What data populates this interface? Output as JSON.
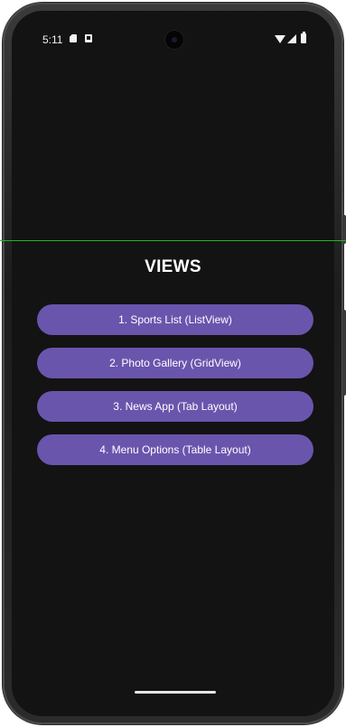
{
  "status_bar": {
    "time": "5:11"
  },
  "page": {
    "title": "VIEWS"
  },
  "menu": {
    "items": [
      {
        "label": "1. Sports List (ListView)"
      },
      {
        "label": "2. Photo Gallery (GridView)"
      },
      {
        "label": "3. News App (Tab Layout)"
      },
      {
        "label": "4. Menu Options (Table Layout)"
      }
    ]
  },
  "colors": {
    "button": "#6a55ad",
    "background": "#131313",
    "guide_line": "#27b327"
  },
  "icons": [
    "sd-card-icon",
    "image-icon",
    "wifi-icon",
    "signal-icon",
    "battery-icon",
    "camera-icon"
  ]
}
